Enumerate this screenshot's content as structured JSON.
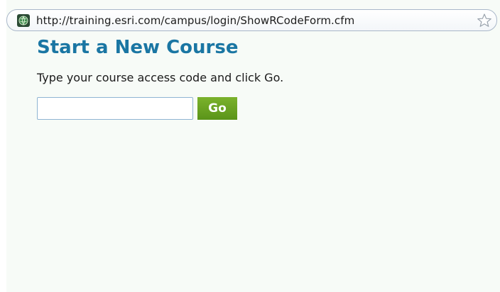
{
  "browser": {
    "url": "http://training.esri.com/campus/login/ShowRCodeForm.cfm",
    "site_icon": "globe-icon",
    "bookmark_icon": "star-icon"
  },
  "page": {
    "title": "Start a New Course",
    "instructions": "Type your course access code and click Go.",
    "access_code": {
      "value": "",
      "placeholder": ""
    },
    "go_label": "Go"
  },
  "colors": {
    "title": "#1a76a3",
    "go_button": "#6aa322",
    "page_background": "#f7fbf7"
  }
}
